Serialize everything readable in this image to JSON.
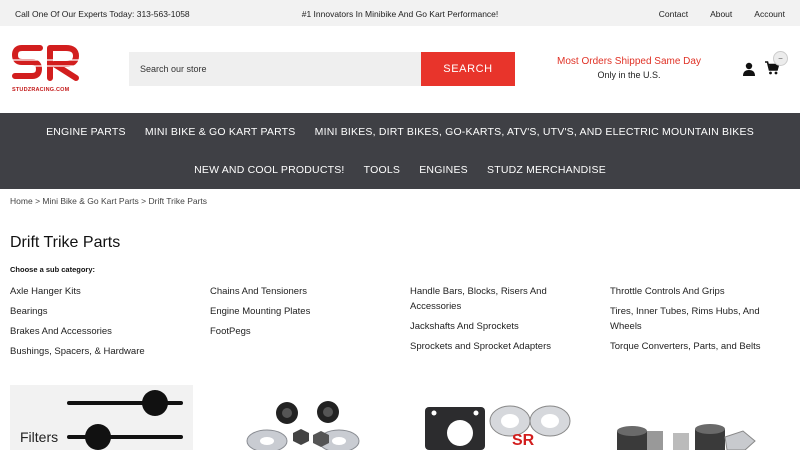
{
  "topbar": {
    "phone": "Call One Of Our Experts Today: 313-563-1058",
    "tagline": "#1 Innovators In Minibike And Go Kart Performance!",
    "links": [
      "Contact",
      "About",
      "Account"
    ]
  },
  "header": {
    "logo_url_text": "STUDZRACING.COM",
    "search_placeholder": "Search our store",
    "search_button": "SEARCH",
    "shipping_line1": "Most Orders Shipped Same Day",
    "shipping_line2": "Only in the U.S.",
    "cart_count": "",
    "accent_color": "#e8342b"
  },
  "nav": {
    "row1": [
      "ENGINE PARTS",
      "MINI BIKE & GO KART PARTS",
      "MINI BIKES, DIRT BIKES, GO-KARTS, ATV'S, UTV'S, AND ELECTRIC MOUNTAIN BIKES"
    ],
    "row2": [
      "NEW AND COOL PRODUCTS!",
      "TOOLS",
      "ENGINES",
      "STUDZ MERCHANDISE"
    ]
  },
  "breadcrumb": [
    "Home",
    "Mini Bike & Go Kart Parts",
    "Drift Trike Parts"
  ],
  "page": {
    "title": "Drift Trike Parts",
    "subcategory_label": "Choose a sub category:",
    "columns": [
      [
        "Axle Hanger Kits",
        "Bearings",
        "Brakes And Accessories",
        "Bushings, Spacers, & Hardware"
      ],
      [
        "Chains And Tensioners",
        "Engine Mounting Plates",
        "FootPegs"
      ],
      [
        "Handle Bars, Blocks, Risers And Accessories",
        "Jackshafts And Sprockets",
        "Sprockets and Sprocket Adapters"
      ],
      [
        "Throttle Controls And Grips",
        "Tires, Inner Tubes, Rims Hubs, And Wheels",
        "Torque Converters, Parts, and Belts"
      ]
    ],
    "filters_label": "Filters"
  }
}
